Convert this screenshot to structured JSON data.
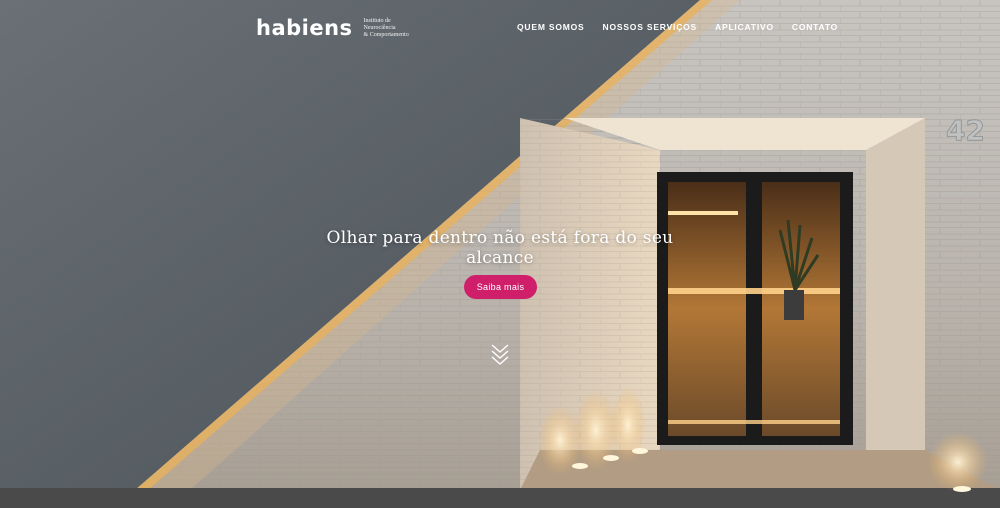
{
  "brand": {
    "logo": "habiens",
    "tagline": [
      "Instituto de",
      "Neurociência",
      "& Comportamento"
    ]
  },
  "nav": {
    "items": [
      "QUEM SOMOS",
      "NOSSOS SERVIÇOS",
      "APLICATIVO",
      "CONTATO"
    ]
  },
  "hero": {
    "headline": "Olhar para dentro não está fora do seu alcance",
    "cta_label": "Saiba mais",
    "house_number": "42",
    "scroll_icon": "double-chevron-down-icon"
  },
  "colors": {
    "accent": "#cf1f6b",
    "wall": "#5b6065",
    "brick_light": "#d4cfc8",
    "warm_light": "#f1b25a"
  }
}
